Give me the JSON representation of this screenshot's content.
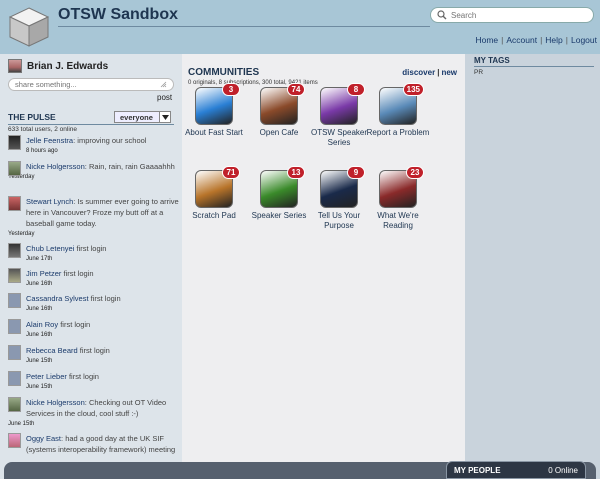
{
  "header": {
    "title": "OTSW Sandbox",
    "search_placeholder": "Search",
    "nav": [
      "Home",
      "Account",
      "Help",
      "Logout"
    ]
  },
  "user": {
    "name": "Brian J. Edwards",
    "share_placeholder": "share something...",
    "post_label": "post"
  },
  "pulse": {
    "title": "THE PULSE",
    "filter": "everyone",
    "stats": "633 total users, 2 online",
    "items": [
      {
        "name": "Jelle Feenstra",
        "text": ": improving our school",
        "time": "8 hours ago"
      },
      {
        "name": "Nicke Holgersson",
        "text": ": Rain, rain, rain Gaaaahhh",
        "time": "Yesterday"
      },
      {
        "name": "Stewart Lynch",
        "text": ": Is summer ever going to arrive here in Vancouver? Froze my butt off at a baseball game today.",
        "time": "Yesterday"
      },
      {
        "name": "Chub Letenyei",
        "text": " first login",
        "time": "June 17th"
      },
      {
        "name": "Jim Petzer",
        "text": " first login",
        "time": "June 16th"
      },
      {
        "name": "Cassandra Sylvest",
        "text": " first login",
        "time": "June 16th"
      },
      {
        "name": "Alain Roy",
        "text": " first login",
        "time": "June 16th"
      },
      {
        "name": "Rebecca Beard",
        "text": " first login",
        "time": "June 15th"
      },
      {
        "name": "Peter Lieber",
        "text": " first login",
        "time": "June 15th"
      },
      {
        "name": "Nicke Holgersson",
        "text": ": Checking out OT Video Services in the cloud, cool stuff :-)",
        "time": "June 15th"
      },
      {
        "name": "Oggy East",
        "text": ": had a good day at the UK SIF (systems interoperability framework) meeting",
        "time": ""
      }
    ]
  },
  "communities": {
    "title": "COMMUNITIES",
    "discover_label": "discover",
    "new_label": "new",
    "stats": "0 originals, 8 subscriptions, 300 total, 9421 items",
    "tiles": [
      {
        "label": "About Fast Start",
        "badge": "3",
        "color": "#2a7fd4"
      },
      {
        "label": "Open Cafe",
        "badge": "74",
        "color": "#8a4a2a"
      },
      {
        "label": "OTSW Speaker Series",
        "badge": "8",
        "color": "#7a3aa8"
      },
      {
        "label": "Report a Problem",
        "badge": "135",
        "color": "#5a8ab8"
      },
      {
        "label": "Scratch Pad",
        "badge": "71",
        "color": "#b8742a"
      },
      {
        "label": "Speaker Series",
        "badge": "13",
        "color": "#3a8a2a"
      },
      {
        "label": "Tell Us Your Purpose",
        "badge": "9",
        "color": "#1a2a4a"
      },
      {
        "label": "What We're Reading",
        "badge": "23",
        "color": "#8a2a2a"
      }
    ]
  },
  "tags": {
    "title": "MY TAGS",
    "items": [
      "PR"
    ]
  },
  "people": {
    "label": "MY PEOPLE",
    "online": "0 Online"
  }
}
